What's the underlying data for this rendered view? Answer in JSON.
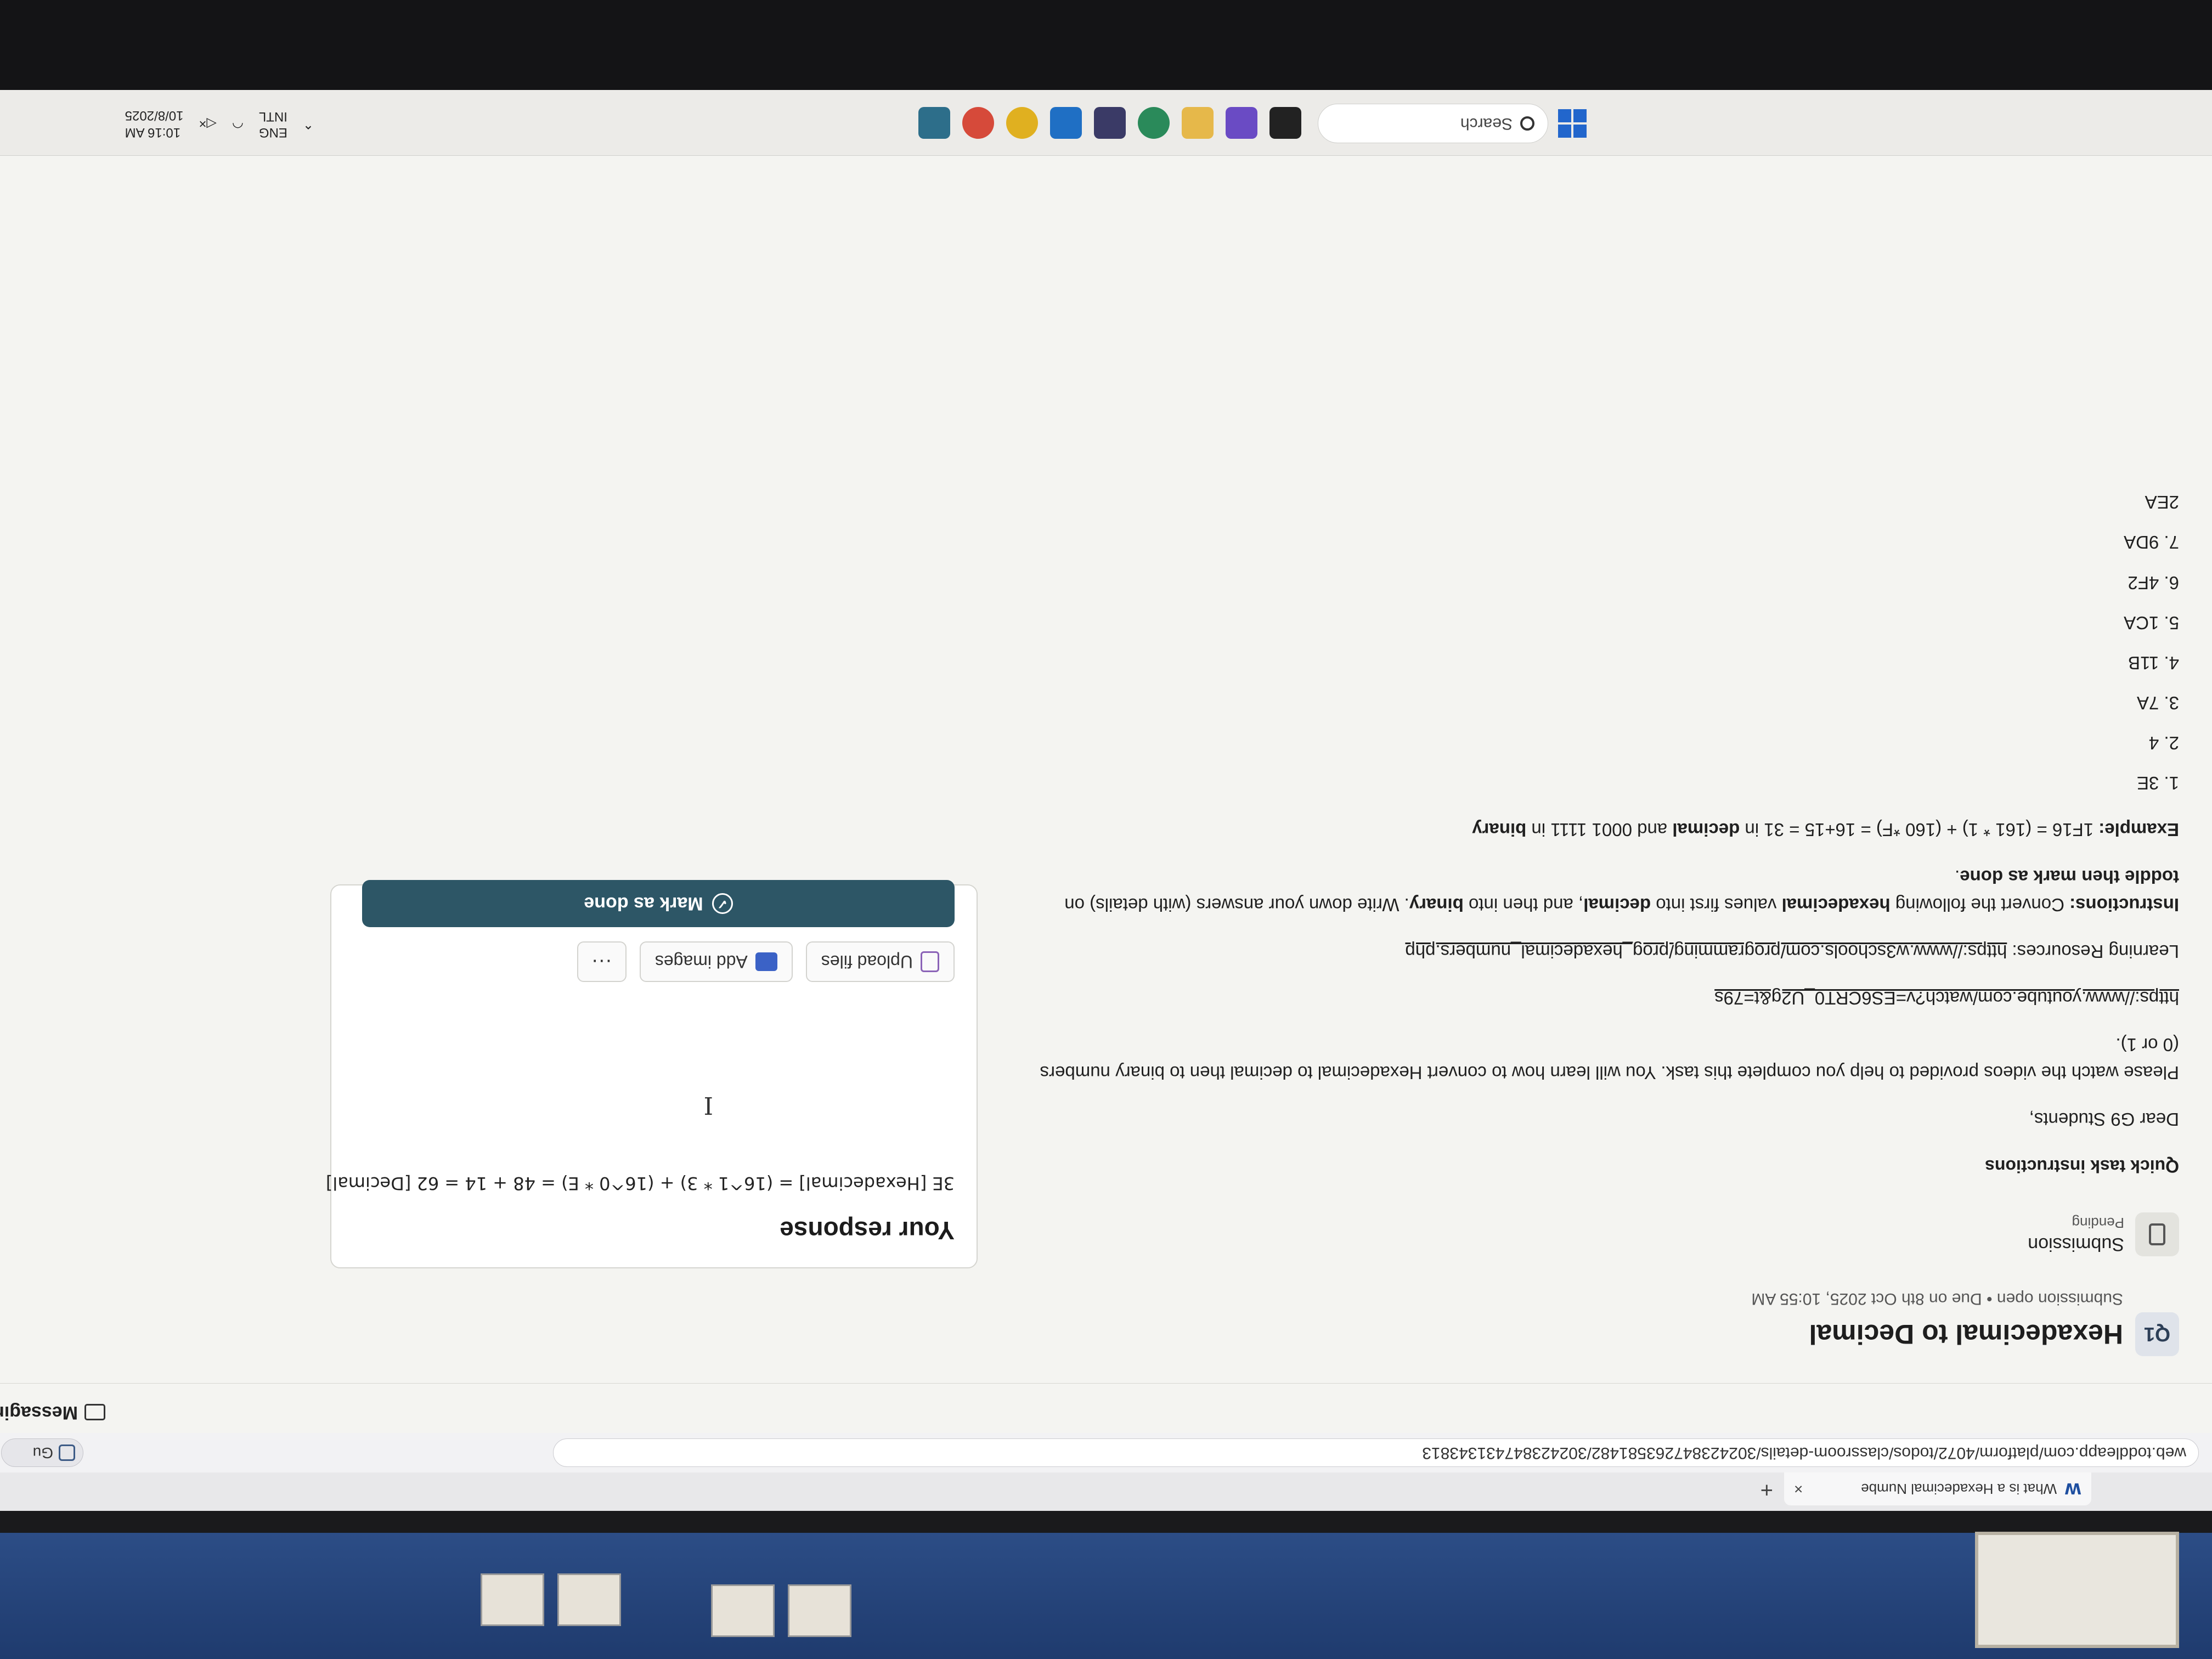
{
  "browser": {
    "tab_title": "What is a Hexadecimal Numbe",
    "tab_favicon": "W",
    "url": "web.toddleapp.com/platform/4072/todos/classroom-details/30242384726358148​2/302423847431343813",
    "guest_label": "Gu"
  },
  "header": {
    "messaging_label": "Messaging"
  },
  "task": {
    "badge": "Q1",
    "title": "Hexadecimal to Decimal",
    "meta": "Submission open • Due on 8th Oct 2025, 10:55 AM",
    "submission_label": "Submission",
    "submission_status": "Pending",
    "instructions_heading": "Quick task instructions",
    "greeting": "Dear G9 Students,",
    "paragraph1": "Please watch the videos provided to help you complete this task. You will learn how to convert Hexadecimal to decimal then to binary numbers (0 or 1).",
    "video_link": "https://www.youtube.com/watch?v=ES6CRT0_U2g&t=79s",
    "resources_label": "Learning Resources:",
    "resources_link": "https://www.w3schools.com/programming/prog_hexadecimal_numbers.php",
    "instructions_label": "Instructions:",
    "instructions_text_a": "Convert the following",
    "instructions_bold_a": "hexadecimal",
    "instructions_text_b": "values first into",
    "instructions_bold_b": "decimal",
    "instructions_text_c": ", and then into",
    "instructions_bold_c": "binary",
    "instructions_text_d": ". Write down your answers (with details) on",
    "instructions_bold_d": "toddle then mark as done",
    "instructions_text_e": ".",
    "example_label": "Example:",
    "example_text": "1F16 = (161 * 1) + (160 *F) = 16+15 = 31 in",
    "example_bold_1": "decimal",
    "example_text_2": "and 0001 1111 in",
    "example_bold_2": "binary",
    "items": [
      "1. 3E",
      "2. 4",
      "3. 7A",
      "4. 11B",
      "5. 1CA",
      "6. 4F2",
      "7. 9DA",
      "2EA"
    ]
  },
  "response": {
    "title": "Your response",
    "text": "3E [Hexadecimal] = (16^1 * 3) + (16^0 * E) = 48 + 14 = 62 [Decimal]",
    "upload_label": "Upload files",
    "images_label": "Add images",
    "more_label": "···",
    "done_label": "Mark as done"
  },
  "taskbar": {
    "search_placeholder": "Search",
    "lang": "ENG",
    "layout": "INTL",
    "time": "10:16 AM",
    "date": "10/8/2025"
  },
  "colors": {
    "done_button": "#2d5666",
    "board": "#2c4d86",
    "page_bg": "#f4f4f1"
  }
}
